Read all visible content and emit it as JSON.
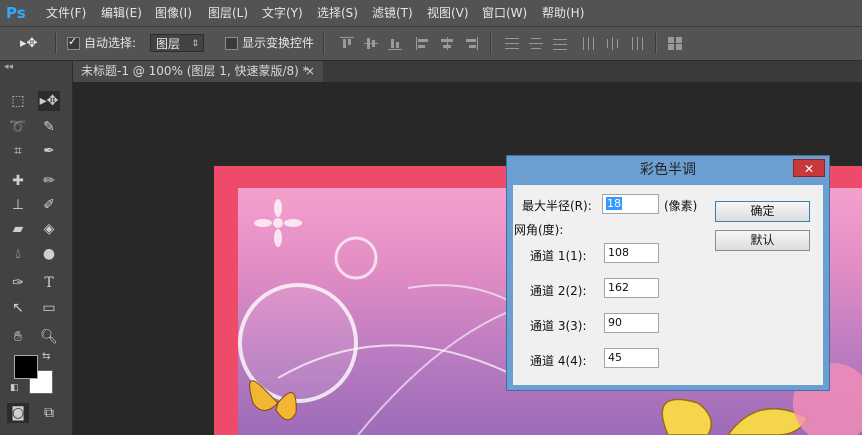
{
  "app": {
    "logo": "Ps",
    "accent": "#31a8ff"
  },
  "menu": [
    "文件(F)",
    "编辑(E)",
    "图像(I)",
    "图层(L)",
    "文字(Y)",
    "选择(S)",
    "滤镜(T)",
    "视图(V)",
    "窗口(W)",
    "帮助(H)"
  ],
  "options": {
    "auto_select_label": "自动选择:",
    "auto_select_checked": true,
    "auto_select_target": "图层",
    "show_transform_label": "显示变换控件",
    "show_transform_checked": false
  },
  "tab": {
    "title": "未标题-1 @ 100% (图层 1, 快速蒙版/8) *",
    "close": "×"
  },
  "dialog": {
    "title": "彩色半调",
    "close": "✕",
    "max_radius_label": "最大半径(R):",
    "max_radius_value": "18",
    "max_radius_unit": "(像素)",
    "screen_angle_label": "网角(度):",
    "channels": [
      {
        "label": "通道 1(1):",
        "value": "108"
      },
      {
        "label": "通道 2(2):",
        "value": "162"
      },
      {
        "label": "通道 3(3):",
        "value": "90"
      },
      {
        "label": "通道 4(4):",
        "value": "45"
      }
    ],
    "ok_label": "确定",
    "default_label": "默认"
  }
}
